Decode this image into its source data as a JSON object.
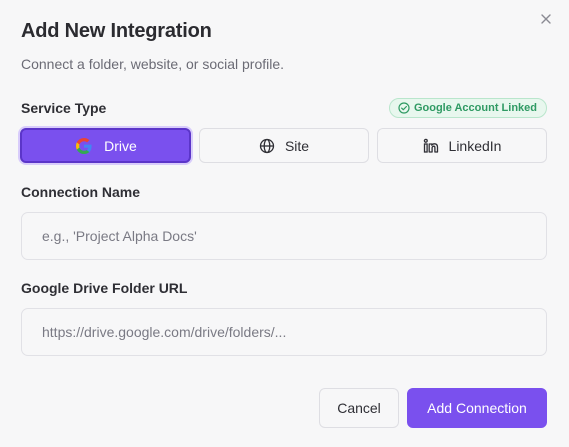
{
  "dialog": {
    "title": "Add New Integration",
    "subtitle": "Connect a folder, website, or social profile.",
    "close_icon": "close-icon"
  },
  "service": {
    "label": "Service Type",
    "badge": "Google Account Linked",
    "badge_icon": "check-circle-icon",
    "options": [
      {
        "label": "Drive",
        "icon": "google-icon",
        "selected": true
      },
      {
        "label": "Site",
        "icon": "globe-icon",
        "selected": false
      },
      {
        "label": "LinkedIn",
        "icon": "linkedin-icon",
        "selected": false
      }
    ]
  },
  "connection_name": {
    "label": "Connection Name",
    "placeholder": "e.g., 'Project Alpha Docs'",
    "value": ""
  },
  "folder_url": {
    "label": "Google Drive Folder URL",
    "placeholder": "https://drive.google.com/drive/folders/...",
    "value": ""
  },
  "actions": {
    "cancel": "Cancel",
    "submit": "Add Connection"
  },
  "colors": {
    "accent": "#7a50ee",
    "success": "#2f9a63",
    "background": "#f7f7f8"
  }
}
